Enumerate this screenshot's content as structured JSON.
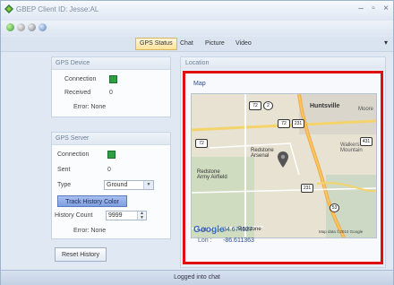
{
  "window": {
    "title": "GBEP Client ID: Jesse:AL",
    "minimize": "–",
    "maximize": "▫",
    "close": "×"
  },
  "toolbar": {
    "icons": [
      "connect-icon",
      "gray-icon-1",
      "gray-icon-2",
      "globe-icon"
    ]
  },
  "tabs": [
    {
      "label": "GPS Status",
      "active": true
    },
    {
      "label": "Chat",
      "active": false
    },
    {
      "label": "Picture",
      "active": false
    },
    {
      "label": "Video",
      "active": false
    }
  ],
  "tab_menu": "▾",
  "gps_device": {
    "title": "GPS Device",
    "connection_label": "Connection",
    "received_label": "Received",
    "received_value": "0",
    "error_label": "Error: None"
  },
  "gps_server": {
    "title": "GPS Server",
    "connection_label": "Connection",
    "sent_label": "Sent",
    "sent_value": "0",
    "type_label": "Type",
    "type_value": "Ground",
    "track_history_color": "Track History Color",
    "history_count_label": "History Count",
    "history_count_value": "9999",
    "error_label": "Error: None"
  },
  "reset_history": "Reset History",
  "location": {
    "title": "Location",
    "map_label": "Map",
    "lat_label": "Lat :",
    "lat_value": "34.674527",
    "lon_label": "Lon :",
    "lon_value": "-86.611363"
  },
  "map": {
    "labels": {
      "huntsville": "Huntsville",
      "redstone_arsenal": "Redstone\nArsenal",
      "redstone_army_airfield": "Redstone\nArmy Airfield",
      "google": "Google",
      "redstone": "Redstone",
      "map_data": "Map data ©2010 Google",
      "walker_mountain": "Walkers\nMountain",
      "moore": "Moore"
    },
    "shields": [
      "72",
      "2",
      "72",
      "231",
      "72",
      "231",
      "53",
      "431"
    ]
  },
  "status": {
    "text": "Logged into chat"
  },
  "colors": {
    "connection_green": "#2ea043",
    "highlight_frame": "#e01010",
    "track_button": "#8fabe6"
  }
}
